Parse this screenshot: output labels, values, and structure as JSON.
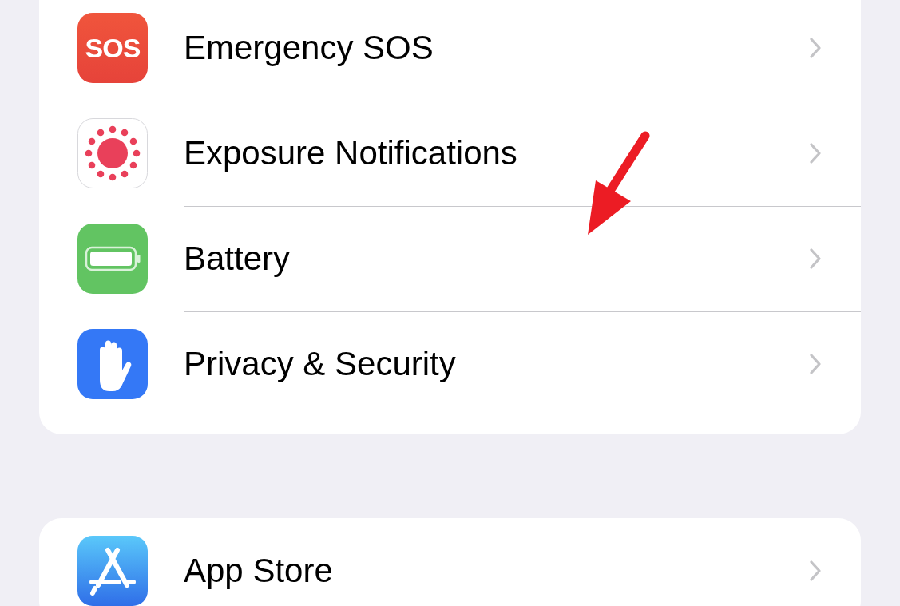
{
  "groups": [
    {
      "rows": [
        {
          "kind": "sos",
          "icon_text": "SOS",
          "label": "Emergency SOS"
        },
        {
          "kind": "exposure",
          "label": "Exposure Notifications"
        },
        {
          "kind": "battery",
          "label": "Battery"
        },
        {
          "kind": "privacy",
          "label": "Privacy & Security"
        }
      ]
    },
    {
      "rows": [
        {
          "kind": "appstore",
          "label": "App Store"
        }
      ]
    }
  ]
}
